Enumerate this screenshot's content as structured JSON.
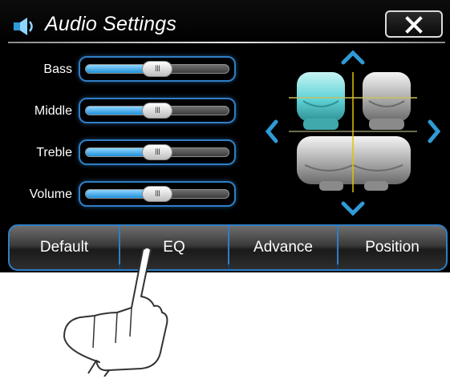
{
  "window": {
    "title": "Audio Settings",
    "icon": "speaker-icon",
    "close_icon": "close-icon"
  },
  "sliders": [
    {
      "label": "Bass",
      "level_percent": 50
    },
    {
      "label": "Middle",
      "level_percent": 50
    },
    {
      "label": "Treble",
      "level_percent": 50
    },
    {
      "label": "Volume",
      "level_percent": 50
    }
  ],
  "slider_thumb_grip": "III",
  "seat_position": {
    "icons": [
      "up-arrow-icon",
      "down-arrow-icon",
      "left-arrow-icon",
      "right-arrow-icon"
    ],
    "selected_seat": "front-left"
  },
  "tabs": [
    "Default",
    "EQ",
    "Advance",
    "Position"
  ],
  "colors": {
    "accent": "#2f7fc6",
    "slider_fill": "#1f8fd8",
    "selected_seat": "#5fd3d6",
    "crosshair_vertical": "#e8c000",
    "crosshair_horizontal": "#c8c060"
  }
}
